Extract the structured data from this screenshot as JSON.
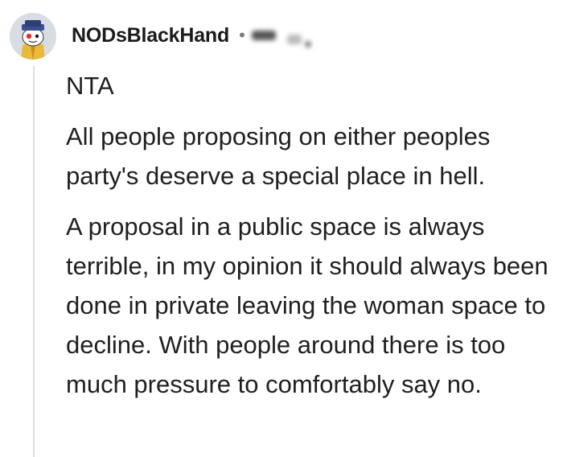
{
  "comment": {
    "author": "NODsBlackHand",
    "separator": "•",
    "avatar_icon": "snoo-avatar-icon",
    "paragraphs": [
      "NTA",
      "All people proposing on either peoples party's deserve a special place in hell.",
      "A proposal in a public space is always terrible, in my opinion it should always been done in private leaving the woman space to decline. With people around there is too much pressure to comfortably say no."
    ]
  },
  "colors": {
    "background": "#ffffff",
    "text": "#1f1f1f",
    "thread_line": "#e0e0e0"
  }
}
